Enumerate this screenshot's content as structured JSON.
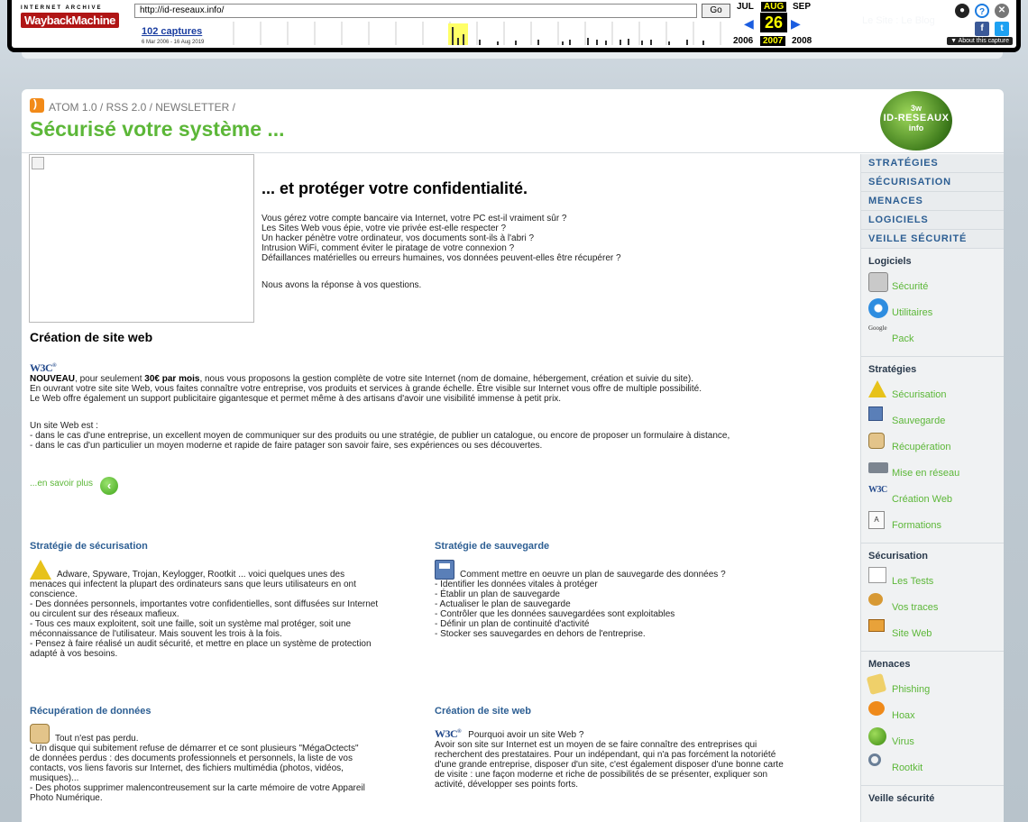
{
  "wayback": {
    "brand_top": "INTERNET ARCHIVE",
    "brand": "WaybackMachine",
    "url": "http://id-reseaux.info/",
    "go_label": "Go",
    "captures_label": "102 captures",
    "date_range": "6 Mar 2006 - 16 Aug 2019",
    "months": [
      "JUL",
      "AUG",
      "SEP"
    ],
    "day": "26",
    "years": [
      "2006",
      "2007",
      "2008"
    ],
    "about_label": "▼ About this capture",
    "icon_names": [
      "user-icon",
      "help-icon",
      "close-icon",
      "facebook-icon",
      "twitter-icon"
    ]
  },
  "site_tag": "Le Site : Le Blog",
  "header": {
    "feeds": "ATOM 1.0 / RSS 2.0 / NEWSLETTER /",
    "title": "Sécurisé votre système ...",
    "logo_top": "3w",
    "logo_main": "ID-RESEAUX",
    "logo_bottom": "info"
  },
  "hero": {
    "title": "... et protéger votre confidentialité.",
    "lines": [
      "Vous gérez votre compte bancaire via Internet, votre PC est-il vraiment sûr ?",
      "Les Sites Web vous épie, votre vie privée est-elle respecter ?",
      "Un hacker pénètre votre ordinateur, vos documents sont-ils à l'abri ?",
      "Intrusion WiFi, comment éviter le piratage de votre connexion ?",
      "Défaillances matérielles ou erreurs humaines, vos données peuvent-elles être récupérer ?"
    ],
    "answer": "Nous avons la réponse à vos questions."
  },
  "web_section": {
    "title": "Création de site web",
    "w3c": "W3C",
    "lead_bold": "NOUVEAU",
    "lead_rest": ", pour seulement ",
    "price": "30€ par mois",
    "lead_tail": ", nous vous proposons la gestion complète de votre site Internet (nom de domaine, hébergement, création et suivie du site).",
    "line2": "En ouvrant votre site site Web, vous faites connaître votre entreprise, vos produits et services à grande échelle. Être visible sur Internet vous offre de multiple possibilité.",
    "line3": "Le Web offre également un support publicitaire gigantesque et permet même à des artisans d'avoir une visibilité immense à petit prix.",
    "para2_intro": "Un site Web est :",
    "para2_a": "- dans le cas d'une entreprise, un excellent moyen de communiquer sur des produits ou une stratégie, de publier un catalogue, ou encore de proposer un formulaire à distance,",
    "para2_b": "- dans le cas d'un particulier un moyen moderne et rapide de faire patager son savoir faire, ses expériences ou ses découvertes.",
    "more": "...en savoir plus"
  },
  "columns": {
    "securisation": {
      "title": "Stratégie de sécurisation",
      "lines": [
        "Adware, Spyware, Trojan, Keylogger, Rootkit ... voici quelques unes des",
        "menaces qui infectent la plupart des ordinateurs sans que leurs utilisateurs en ont",
        "conscience.",
        "- Des données personnels, importantes votre confidentielles, sont diffusées sur Internet",
        "ou circulent sur des réseaux mafieux.",
        "- Tous ces maux exploitent, soit une faille, soit un système mal protéger, soit une",
        "méconnaissance de l'utilisateur. Mais souvent les trois à la fois.",
        "- Pensez à faire réalisé un audit sécurité, et mettre en place un système de protection",
        "adapté à vos besoins."
      ]
    },
    "sauvegarde": {
      "title": "Stratégie de sauvegarde",
      "lines": [
        "Comment mettre en oeuvre un plan de sauvegarde des données ?",
        "- Identifier les données vitales à protéger",
        "- Établir un plan de sauvegarde",
        "- Actualiser le plan de sauvegarde",
        "- Contrôler que les données sauvegardées sont exploitables",
        "- Définir un plan de continuité d'activité",
        "- Stocker ses sauvegardes en dehors de l'entreprise."
      ]
    },
    "recuperation": {
      "title": "Récupération de données",
      "lines": [
        "Tout n'est pas perdu.",
        "- Un disque qui subitement refuse de démarrer et ce sont plusieurs \"MégaOctects\"",
        "de données perdus : des documents professionnels et personnels, la liste de vos",
        "contacts, vos liens favoris sur Internet, des fichiers multimédia (photos, vidéos,",
        "musiques)...",
        "- Des photos supprimer malencontreusement sur la carte mémoire de votre Appareil",
        "Photo Numérique."
      ]
    },
    "creation": {
      "title": "Création de site web",
      "lines": [
        "Pourquoi avoir un site Web ?",
        "Avoir son site sur Internet est un moyen de se faire connaître des entreprises qui",
        "recherchent des prestataires. Pour un indépendant, qui n'a pas forcément la notoriété",
        "d'une grande entreprise, disposer d'un site, c'est également disposer d'une bonne carte",
        "de visite : une façon moderne et riche de possibilités de se présenter, expliquer son",
        "activité, développer ses points forts."
      ]
    }
  },
  "sidebar": {
    "nav": [
      "STRATÉGIES",
      "SÉCURISATION",
      "MENACES",
      "LOGICIELS",
      "VEILLE SÉCURITÉ"
    ],
    "groups": [
      {
        "title": "Logiciels",
        "items": [
          {
            "label": "Sécurité",
            "icon": "lock"
          },
          {
            "label": "Utilitaires",
            "icon": "gear"
          },
          {
            "label": "Pack",
            "icon": "google"
          }
        ]
      },
      {
        "title": "Stratégies",
        "items": [
          {
            "label": "Sécurisation",
            "icon": "warn"
          },
          {
            "label": "Sauvegarde",
            "icon": "disk"
          },
          {
            "label": "Récupération",
            "icon": "box"
          },
          {
            "label": "Mise en réseau",
            "icon": "net"
          },
          {
            "label": "Création Web",
            "icon": "w3c"
          },
          {
            "label": "Formations",
            "icon": "doc"
          }
        ]
      },
      {
        "title": "Sécurisation",
        "items": [
          {
            "label": "Les Tests",
            "icon": "list"
          },
          {
            "label": "Vos traces",
            "icon": "cookie"
          },
          {
            "label": "Site Web",
            "icon": "cal"
          }
        ]
      },
      {
        "title": "Menaces",
        "items": [
          {
            "label": "Phishing",
            "icon": "hook"
          },
          {
            "label": "Hoax",
            "icon": "bubble"
          },
          {
            "label": "Virus",
            "icon": "virus"
          },
          {
            "label": "Rootkit",
            "icon": "mag"
          }
        ]
      },
      {
        "title": "Veille sécurité",
        "items": []
      }
    ]
  }
}
